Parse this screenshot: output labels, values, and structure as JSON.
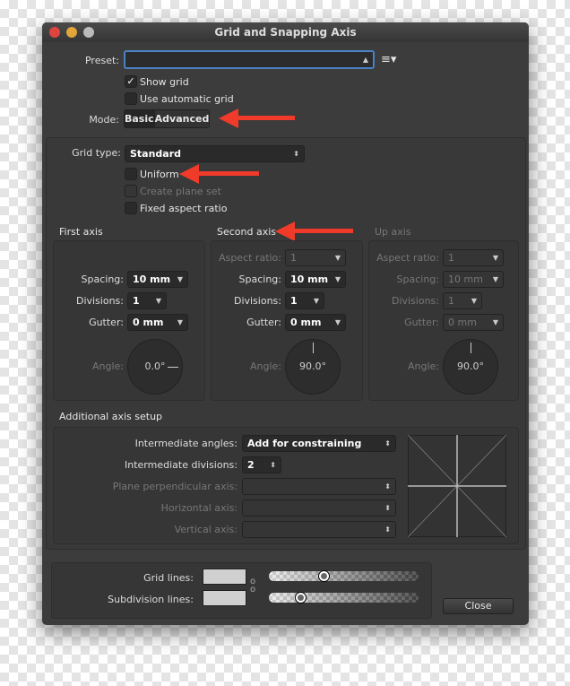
{
  "window": {
    "title": "Grid and Snapping Axis"
  },
  "preset": {
    "label": "Preset:",
    "value": ""
  },
  "show_grid": {
    "label": "Show grid",
    "checked": true
  },
  "auto_grid": {
    "label": "Use automatic grid",
    "checked": false
  },
  "mode": {
    "label": "Mode:",
    "options": [
      "Basic",
      "Advanced"
    ],
    "selected": "Advanced"
  },
  "grid_type": {
    "label": "Grid type:",
    "value": "Standard"
  },
  "uniform": {
    "label": "Uniform",
    "checked": false
  },
  "plane_set": {
    "label": "Create plane set",
    "checked": false
  },
  "fixed_aspect": {
    "label": "Fixed aspect ratio",
    "checked": false
  },
  "axes": [
    {
      "title": "First axis",
      "spacing": "10 mm",
      "divisions": "1",
      "gutter": "0 mm",
      "angle": "0.0°"
    },
    {
      "title": "Second axis",
      "aspect": "1",
      "spacing": "10 mm",
      "divisions": "1",
      "gutter": "0 mm",
      "angle": "90.0°"
    },
    {
      "title": "Up axis",
      "aspect": "1",
      "spacing": "10 mm",
      "divisions": "1",
      "gutter": "0 mm",
      "angle": "90.0°"
    }
  ],
  "labels": {
    "aspect": "Aspect ratio:",
    "spacing": "Spacing:",
    "divisions": "Divisions:",
    "gutter": "Gutter:",
    "angle": "Angle:"
  },
  "additional": {
    "title": "Additional axis setup",
    "int_angles_label": "Intermediate angles:",
    "int_angles": "Add for constraining",
    "int_div_label": "Intermediate divisions:",
    "int_div": "2",
    "plane_perp_label": "Plane perpendicular axis:",
    "horizontal_label": "Horizontal axis:",
    "vertical_label": "Vertical axis:"
  },
  "lines": {
    "grid_label": "Grid lines:",
    "grid_opacity": 0.36,
    "sub_label": "Subdivision lines:",
    "sub_opacity": 0.19,
    "color": "#d0d0d0"
  },
  "close": "Close",
  "colors": {
    "annotation_arrow": "#f03a2a",
    "focus": "#4a82c4"
  }
}
